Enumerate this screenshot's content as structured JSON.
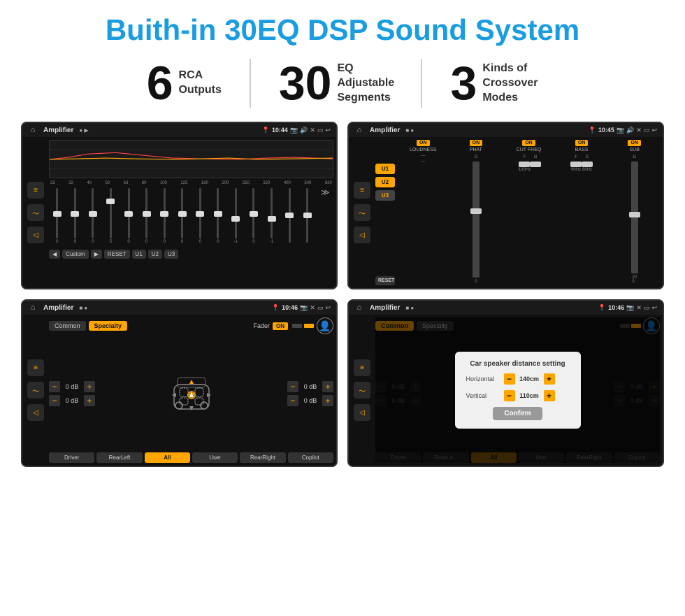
{
  "header": {
    "title": "Buith-in 30EQ DSP Sound System"
  },
  "stats": [
    {
      "number": "6",
      "text": "RCA\nOutputs"
    },
    {
      "number": "30",
      "text": "EQ Adjustable\nSegments"
    },
    {
      "number": "3",
      "text": "Kinds of\nCrossover Modes"
    }
  ],
  "screens": [
    {
      "id": "eq-screen",
      "title": "Amplifier",
      "time": "10:44",
      "type": "eq"
    },
    {
      "id": "crossover-screen",
      "title": "Amplifier",
      "time": "10:45",
      "type": "crossover"
    },
    {
      "id": "fader-screen",
      "title": "Amplifier",
      "time": "10:46",
      "type": "fader"
    },
    {
      "id": "distance-screen",
      "title": "Amplifier",
      "time": "10:46",
      "type": "distance"
    }
  ],
  "eq": {
    "freqs": [
      "25",
      "32",
      "40",
      "50",
      "63",
      "80",
      "100",
      "125",
      "160",
      "200",
      "250",
      "320",
      "400",
      "500",
      "630"
    ],
    "values": [
      "0",
      "0",
      "0",
      "5",
      "0",
      "0",
      "0",
      "0",
      "0",
      "0",
      "-1",
      "0",
      "-1",
      "",
      ""
    ],
    "preset": "Custom",
    "buttons": [
      "RESET",
      "U1",
      "U2",
      "U3"
    ]
  },
  "crossover": {
    "presets": [
      "U1",
      "U2",
      "U3"
    ],
    "channels": [
      {
        "label": "LOUDNESS",
        "on": true
      },
      {
        "label": "PHAT",
        "on": true
      },
      {
        "label": "CUT FREQ",
        "on": true
      },
      {
        "label": "BASS",
        "on": true
      },
      {
        "label": "SUB",
        "on": true
      }
    ],
    "resetLabel": "RESET"
  },
  "fader": {
    "tabs": [
      "Common",
      "Specialty"
    ],
    "activeTab": "Specialty",
    "faderLabel": "Fader",
    "onLabel": "ON",
    "dbValues": [
      "0 dB",
      "0 dB",
      "0 dB",
      "0 dB"
    ],
    "zones": [
      "Driver",
      "RearLeft",
      "All",
      "User",
      "RearRight",
      "Copilot"
    ]
  },
  "distance": {
    "tabs": [
      "Common",
      "Specialty"
    ],
    "activeTab": "Common",
    "dialogTitle": "Car speaker distance setting",
    "horizontalLabel": "Horizontal",
    "horizontalValue": "140cm",
    "verticalLabel": "Vertical",
    "verticalValue": "110cm",
    "confirmLabel": "Confirm",
    "dbValues": [
      "0 dB",
      "0 dB"
    ],
    "zones": [
      "Driver",
      "RearLeft",
      "All",
      "User",
      "RearRight",
      "Copilot"
    ]
  }
}
